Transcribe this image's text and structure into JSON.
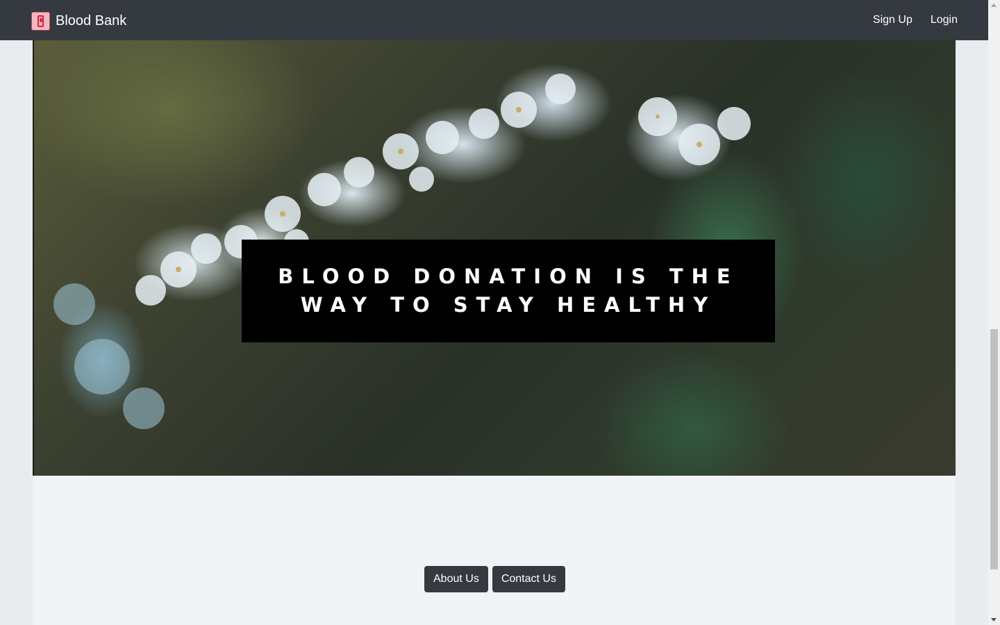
{
  "navbar": {
    "brand_icon": "blood-bag-icon",
    "brand_text": "Blood Bank",
    "links": [
      {
        "label": "Sign Up"
      },
      {
        "label": "Login"
      }
    ]
  },
  "hero": {
    "image_description_icon": "flower-branch-image",
    "quote": "Blood donation is the way to stay healthy"
  },
  "footer": {
    "about_label": "About Us",
    "contact_label": "Contact Us"
  },
  "colors": {
    "navbar_bg": "#343a40",
    "button_bg": "#343a40",
    "quote_bg": "#000000",
    "page_bg": "#e9ecef",
    "content_bg": "#f1f3f6"
  }
}
